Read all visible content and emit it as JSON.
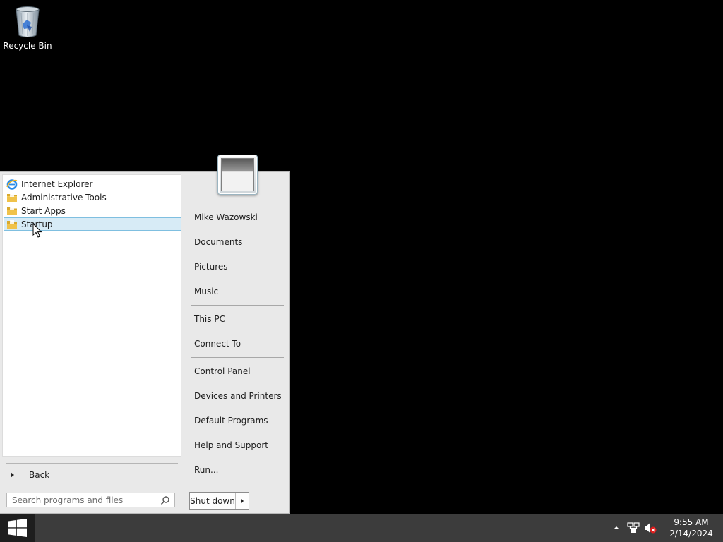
{
  "desktop": {
    "icons": [
      {
        "label": "Recycle Bin",
        "icon": "recycle-bin-icon"
      }
    ]
  },
  "start_menu": {
    "programs": [
      {
        "label": "Internet Explorer",
        "icon": "internet-explorer-icon",
        "selected": false
      },
      {
        "label": "Administrative Tools",
        "icon": "folder-icon",
        "selected": false
      },
      {
        "label": "Start Apps",
        "icon": "folder-icon",
        "selected": false
      },
      {
        "label": "Startup",
        "icon": "folder-icon",
        "selected": true
      }
    ],
    "back_label": "Back",
    "search": {
      "placeholder": "Search programs and files",
      "value": ""
    },
    "right_links": [
      {
        "label": "Mike Wazowski"
      },
      {
        "label": "Documents"
      },
      {
        "label": "Pictures"
      },
      {
        "label": "Music"
      },
      {
        "label": "This PC"
      },
      {
        "label": "Connect To"
      },
      {
        "label": "Control Panel"
      },
      {
        "label": "Devices and Printers"
      },
      {
        "label": "Default Programs"
      },
      {
        "label": "Help and Support"
      },
      {
        "label": "Run..."
      }
    ],
    "shutdown_label": "Shut down"
  },
  "taskbar": {
    "tray_icons": [
      "show-hidden-icons-chevron-icon",
      "network-icon",
      "volume-muted-icon"
    ],
    "clock": {
      "time": "9:55 AM",
      "date": "2/14/2024"
    }
  },
  "colors": {
    "desktop_background": "#000000",
    "taskbar": "#3c3c3c",
    "start_menu_background": "#e9e9e9",
    "selected_item": "#d7ebf6",
    "selected_border": "#7fbfe0"
  }
}
